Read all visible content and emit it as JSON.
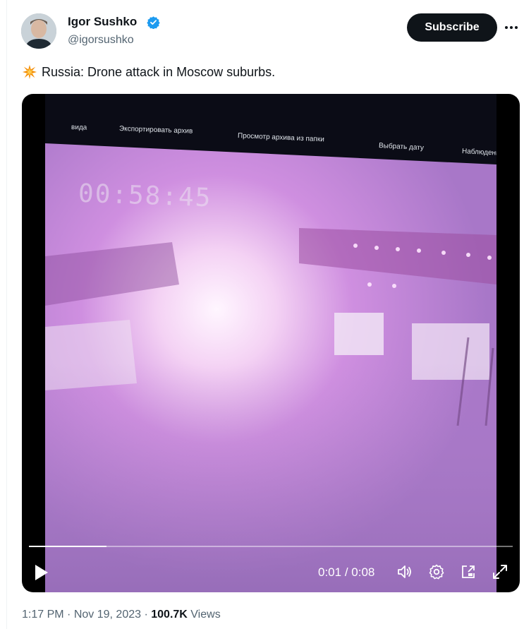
{
  "author": {
    "name": "Igor Sushko",
    "handle": "@igorsushko",
    "verified": true,
    "verified_color": "#1d9bf0"
  },
  "actions": {
    "subscribe_label": "Subscribe",
    "more_icon": "more-horizontal-icon"
  },
  "tweet": {
    "emoji_icon": "collision-icon",
    "text": "Russia: Drone attack in Moscow suburbs."
  },
  "video": {
    "toolbar_items": [
      "вида",
      "Экспортировать архив",
      "Просмотр архива из папки",
      "Выбрать дату",
      "Наблюдение"
    ],
    "timestamp_overlay": "00:58:45",
    "progress_fraction": 0.16,
    "current_time": "0:01",
    "duration": "0:08",
    "controls": [
      "play-icon",
      "volume-icon",
      "settings-icon",
      "pop-out-icon",
      "fullscreen-icon"
    ]
  },
  "meta": {
    "time": "1:17 PM",
    "separator": "·",
    "date": "Nov 19, 2023",
    "views_count": "100.7K",
    "views_label": "Views"
  }
}
